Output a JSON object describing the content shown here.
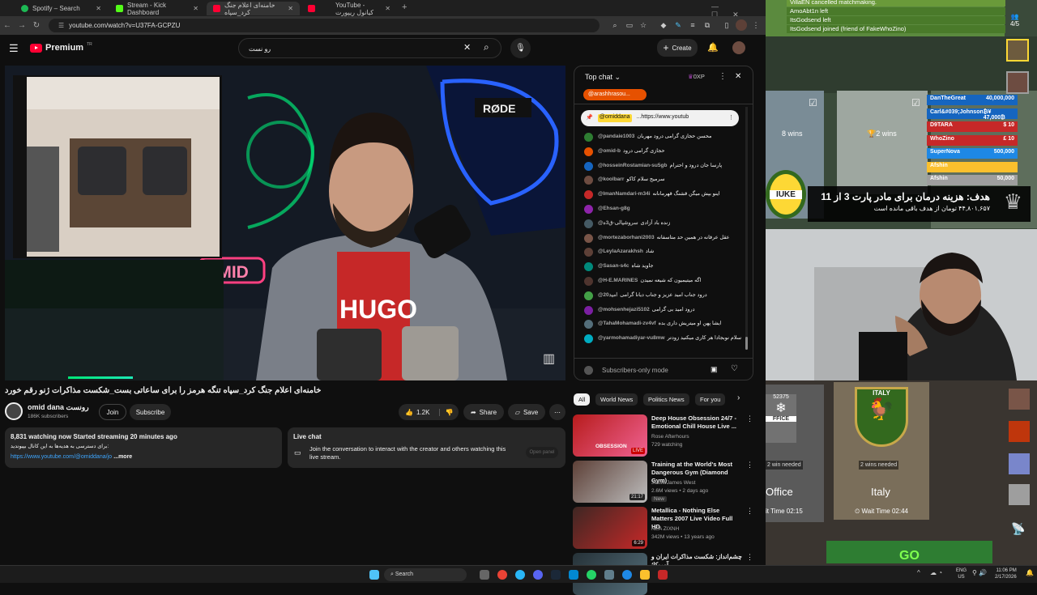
{
  "browser": {
    "tabs": [
      {
        "label": "Spotify – Search",
        "color": "#1db954"
      },
      {
        "label": "Stream - Kick Dashboard",
        "color": "#53fc18"
      },
      {
        "label": "خامنه‌ای اعلام جنگ کرد_سپاه",
        "color": "#ff0033"
      },
      {
        "label": "YouTube - کیانول ریپورت",
        "color": "#ff0033"
      }
    ],
    "url": "youtube.com/watch?v=U37FA-GCPZU"
  },
  "youtube": {
    "logo_text": "Premium",
    "logo_sup": "TR",
    "search_value": "رو نست",
    "create_label": "Create",
    "video_title": "خامنه‌ای اعلام جنگ کرد_سپاه تنگه هرمز را برای ساعاتی بست_شکست مذاکرات ژنو رقم خورد",
    "channel_name": "omid dana رونست",
    "subscribers": "186K subscribers",
    "join_label": "Join",
    "subscribe_label": "Subscribe",
    "likes": "1.2K",
    "share_label": "Share",
    "save_label": "Save",
    "desc_stats": "8,831 watching now  Started streaming 20 minutes ago",
    "desc_line": "برای دسترسی به هدیه‌ها به این کانال بپیوندید:",
    "desc_link": "https://www.youtube.com/@omiddana/jo",
    "desc_more": "...more",
    "livechat_title": "Live chat",
    "livechat_text": "Join the conversation to interact with the creator and others watching this live stream.",
    "open_panel": "Open panel"
  },
  "chat": {
    "header": "Top chat",
    "xp": "0XP",
    "pinned_user": "@arashhrasou...",
    "pinned_msg_user": "@omiddana",
    "pinned_msg_text": "...https://www.youtub",
    "messages": [
      {
        "user": "@pandaie1003",
        "text": "محسن حجازی گرامی درود مهربان",
        "color": "#2e7d32"
      },
      {
        "user": "@omid-b",
        "text": "حجازی گرامی درود",
        "color": "#e65100"
      },
      {
        "user": "@hosseinRostamian-su5gb",
        "text": "پارسا جان درود و احترام",
        "color": "#1565c0"
      },
      {
        "user": "@koolbarr",
        "text": "سرمیج سلام کاکو",
        "color": "#6d4c41"
      },
      {
        "user": "@ImanNamdari-m34i",
        "text": "اینو بپش میگن قشنگ قهرمانانه",
        "color": "#c62828"
      },
      {
        "user": "@Ehsan-g8g",
        "text": "",
        "color": "#8e24aa"
      },
      {
        "user": "@سروشیالی-ق3ه",
        "text": "زنده باد آزادی",
        "color": "#455a64"
      },
      {
        "user": "@mortezaborhani2003",
        "text": "عقل عرفانه در همین حد متاسفانه",
        "color": "#795548"
      },
      {
        "user": "@LeylaAzarakhsh",
        "text": "شاد",
        "color": "#5d4037"
      },
      {
        "user": "@Sasan-s4c",
        "text": "جاوید شاه",
        "color": "#00897b"
      },
      {
        "user": "@H-E.MARINES",
        "text": "اگه میتیمیون که شیعه نمیدن",
        "color": "#4e342e"
      },
      {
        "user": "@امید20",
        "text": "درود جناب امید عزیز و جناب دیانا گرامی",
        "color": "#43a047"
      },
      {
        "user": "@mohsenhejazi5102",
        "text": "درود امید بی گرامی",
        "color": "#7b1fa2"
      },
      {
        "user": "@TahaMohamadi-zv4vf",
        "text": "ایشا پهن او میتریش داری بده",
        "color": "#546e7a"
      },
      {
        "user": "@yarmohamadiyar-vu8mw",
        "text": "سلام نوبجادا هر کاری میکنید زودتر",
        "color": "#00acc1"
      }
    ],
    "footer": "Subscribers-only mode"
  },
  "chips": [
    "All",
    "World News",
    "Politics News",
    "For you"
  ],
  "recommendations": [
    {
      "title": "Deep House Obsession 24/7 - Emotional Chill House Live ...",
      "channel": "Rose Afterhours",
      "meta": "729 watching",
      "badge": "LIVE",
      "thumb_text": "OBSESSION",
      "colors": [
        "#b71c1c",
        "#f06292"
      ]
    },
    {
      "title": "Training at the World's Most Dangerous Gym (Diamond Gym)",
      "channel": "Jesse James West",
      "meta": "2.6M views • 2 days ago",
      "badge": "New",
      "duration": "21:17",
      "colors": [
        "#5d4037",
        "#bdbdbd"
      ]
    },
    {
      "title": "Metallica - Nothing Else Matters 2007 Live Video Full HD",
      "channel": "NEA ZIXNH",
      "meta": "342M views • 13 years ago",
      "duration": "6:29",
      "colors": [
        "#3e2723",
        "#c62828"
      ]
    },
    {
      "title": "چشم‌انداز: شکست مذاکرات ایران و آمریکا؛",
      "channel": "",
      "meta": "",
      "colors": [
        "#263238",
        "#546e7a"
      ]
    }
  ],
  "stream": {
    "events": [
      {
        "text": "VillaEN cancelled matchmaking.",
        "color": "#6a9a3a"
      },
      {
        "text": "AmoAbt1n left",
        "color": "#4a7a2a"
      },
      {
        "text": "ItsGodsend left",
        "color": "#4a7a2a"
      },
      {
        "text": "ItsGodsend joined (friend of FakeWhoZino)",
        "color": "#4a7a2a"
      }
    ],
    "queue": "4/5",
    "leaderboard": [
      {
        "name": "DanTheGreat",
        "value": "40,000,000",
        "color": "#1565c0"
      },
      {
        "name": "Carl&#039;Johnson",
        "value": "₿¥ 47,000₿",
        "color": "#1565c0"
      },
      {
        "name": "D9TARA",
        "value": "$ 10",
        "color": "#c62828"
      },
      {
        "name": "WhoZino",
        "value": "£ 10",
        "color": "#c62828"
      },
      {
        "name": "SuperNova",
        "value": "500,000",
        "color": "#1e88e5"
      },
      {
        "name": "Afshin",
        "value": "",
        "color": "#fbc02d"
      },
      {
        "name": "Afshin",
        "value": "50,000",
        "color": "#9e9e9e"
      }
    ],
    "goal_title": "هدف: هزینه درمان برای مادر پارت 3 از 11",
    "goal_sub": "۴۴,۸۰۱,۶۵۷ تومان از هدف باقی مانده است",
    "wins_1": "8 wins",
    "wins_2": "2 wins",
    "map_left_label": "Office",
    "map_left_sub": "2 win needed",
    "map_left_time": "it Time 02:15",
    "map_left_code": "52375",
    "map_right_label": "Italy",
    "map_right_sub": "2 wins needed",
    "map_right_time": "Wait Time 02:44",
    "map_right_emblem": "ITALY",
    "go_label": "GO",
    "ribbon": "IUKE"
  },
  "taskbar": {
    "search": "Search",
    "lang": "ENG\nUS",
    "time": "11:06 PM",
    "date": "2/17/2026"
  }
}
